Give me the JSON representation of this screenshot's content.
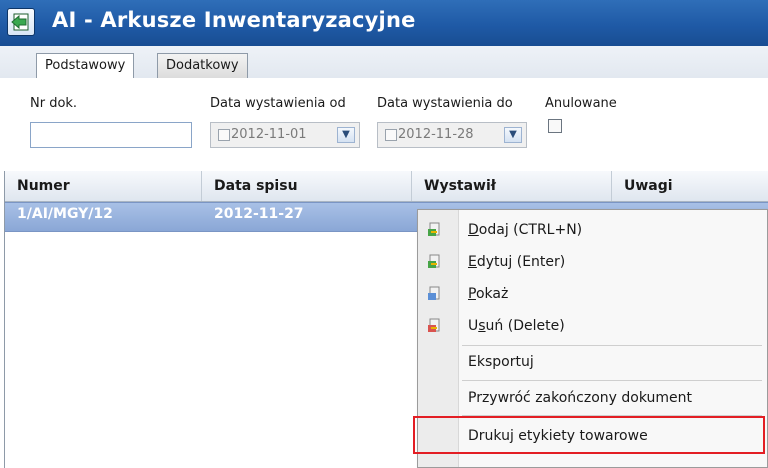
{
  "window": {
    "title": "AI - Arkusze Inwentaryzacyjne",
    "icon": "back-arrow-icon"
  },
  "tabs": [
    {
      "label": "Podstawowy",
      "active": true
    },
    {
      "label": "Dodatkowy",
      "active": false
    }
  ],
  "filters": {
    "nr_dok_label": "Nr dok.",
    "nr_dok_value": "",
    "date_from_label": "Data wystawienia od",
    "date_from_value": "2012-11-01",
    "date_to_label": "Data wystawienia do",
    "date_to_value": "2012-11-28",
    "anulowane_label": "Anulowane"
  },
  "grid": {
    "columns": [
      "Numer",
      "Data spisu",
      "Wystawił",
      "Uwagi"
    ],
    "rows": [
      {
        "numer": "1/AI/MGY/12",
        "data_spisu": "2012-11-27",
        "wystawil": "",
        "uwagi": ""
      }
    ]
  },
  "context_menu": {
    "items": [
      {
        "label": "Dodaj (CTRL+N)",
        "icon": "add-document-icon"
      },
      {
        "label": "Edytuj (Enter)",
        "icon": "edit-document-icon"
      },
      {
        "label": "Pokaż",
        "icon": "view-document-icon"
      },
      {
        "label": "Usuń (Delete)",
        "icon": "delete-document-icon"
      },
      {
        "label": "Eksportuj",
        "icon": ""
      },
      {
        "label": "Przywróć zakończony dokument",
        "icon": ""
      },
      {
        "label": "Drukuj etykiety towarowe",
        "icon": ""
      }
    ]
  },
  "colors": {
    "titlebar": "#1f5aa6",
    "selection": "#8aa7d6",
    "highlight_border": "#e31e24"
  }
}
